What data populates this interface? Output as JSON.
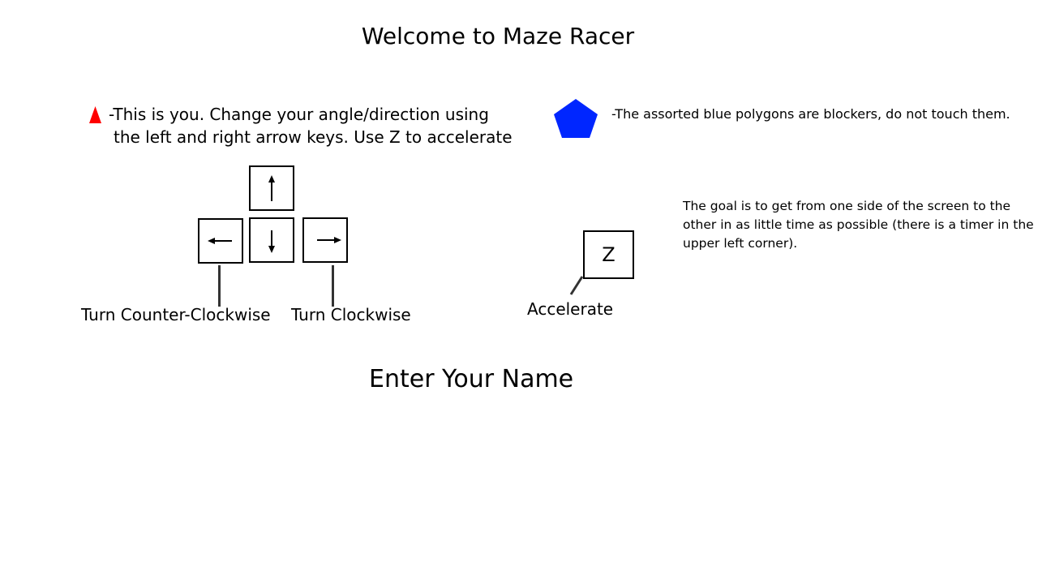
{
  "title": "Welcome to Maze Racer",
  "player": {
    "icon": "red-triangle-icon",
    "color": "#ff0000",
    "line1": "-This is you.  Change your angle/direction using",
    "line2": "the left and right arrow keys.  Use Z to accelerate"
  },
  "blocker": {
    "icon": "blue-pentagon-icon",
    "color": "#0026ff",
    "text": "-The assorted blue polygons are blockers, do not touch them."
  },
  "goal": {
    "text": "The goal is to get from one side of the screen to the other in as little time as possible (there is a timer in the upper left corner)."
  },
  "controls": {
    "keys": [
      "up-arrow-icon",
      "left-arrow-icon",
      "down-arrow-icon",
      "right-arrow-icon"
    ],
    "left_label": "Turn Counter-Clockwise",
    "right_label": "Turn Clockwise",
    "z_key": "Z",
    "z_label": "Accelerate"
  },
  "enter_name": "Enter Your Name"
}
